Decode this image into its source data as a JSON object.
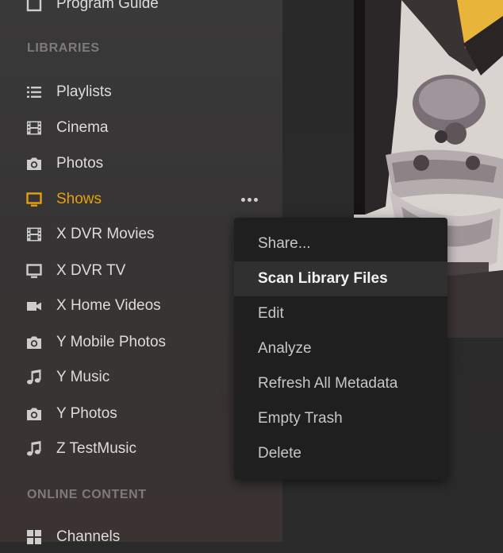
{
  "colors": {
    "accent": "#e5a00d",
    "sidebar_text": "#dedcda",
    "section_header": "#7f7b78",
    "menu_bg": "#1f1f1f",
    "menu_highlight": "#303030"
  },
  "sidebar": {
    "top_item": {
      "label": "Program Guide",
      "icon": "program-guide-icon"
    },
    "libraries_header": "LIBRARIES",
    "items": [
      {
        "label": "Playlists",
        "icon": "list-icon"
      },
      {
        "label": "Cinema",
        "icon": "film-icon"
      },
      {
        "label": "Photos",
        "icon": "camera-icon"
      },
      {
        "label": "Shows",
        "icon": "tv-icon",
        "active": true
      },
      {
        "label": "X DVR Movies",
        "icon": "film-icon"
      },
      {
        "label": "X DVR TV",
        "icon": "tv-icon"
      },
      {
        "label": "X Home Videos",
        "icon": "video-camera-icon"
      },
      {
        "label": "Y Mobile Photos",
        "icon": "camera-icon"
      },
      {
        "label": "Y Music",
        "icon": "music-note-icon"
      },
      {
        "label": "Y Photos",
        "icon": "camera-icon"
      },
      {
        "label": "Z TestMusic",
        "icon": "music-note-icon"
      }
    ],
    "online_header": "ONLINE CONTENT",
    "bottom_item": {
      "label": "Channels",
      "icon": "grid-icon"
    }
  },
  "context_menu": {
    "items": [
      {
        "label": "Share..."
      },
      {
        "label": "Scan Library Files",
        "highlighted": true
      },
      {
        "label": "Edit"
      },
      {
        "label": "Analyze"
      },
      {
        "label": "Refresh All Metadata"
      },
      {
        "label": "Empty Trash"
      },
      {
        "label": "Delete"
      }
    ]
  }
}
